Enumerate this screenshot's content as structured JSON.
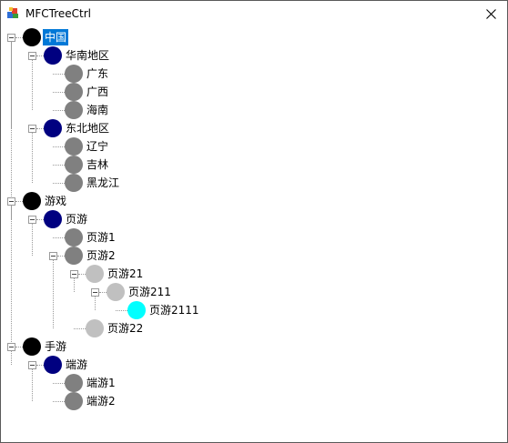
{
  "window": {
    "title": "MFCTreeCtrl",
    "close_glyph": "✕"
  },
  "colors": {
    "level0": "#000000",
    "level1": "#000080",
    "level2": "#808080",
    "level3": "#c0c0c0",
    "level4": "#00ffff",
    "selection": "#0078d7"
  },
  "tree": {
    "items": [
      {
        "label": "中国",
        "depth": 0,
        "expanded": true,
        "selected": true
      },
      {
        "label": "华南地区",
        "depth": 1,
        "expanded": true
      },
      {
        "label": "广东",
        "depth": 2
      },
      {
        "label": "广西",
        "depth": 2
      },
      {
        "label": "海南",
        "depth": 2
      },
      {
        "label": "东北地区",
        "depth": 1,
        "expanded": true
      },
      {
        "label": "辽宁",
        "depth": 2
      },
      {
        "label": "吉林",
        "depth": 2
      },
      {
        "label": "黑龙江",
        "depth": 2
      },
      {
        "label": "游戏",
        "depth": 0,
        "expanded": true
      },
      {
        "label": "页游",
        "depth": 1,
        "expanded": true
      },
      {
        "label": "页游1",
        "depth": 2
      },
      {
        "label": "页游2",
        "depth": 2,
        "expanded": true
      },
      {
        "label": "页游21",
        "depth": 3,
        "expanded": true
      },
      {
        "label": "页游211",
        "depth": 4,
        "expanded": true
      },
      {
        "label": "页游2111",
        "depth": 5
      },
      {
        "label": "页游22",
        "depth": 3
      },
      {
        "label": "手游",
        "depth": 0,
        "expanded": true
      },
      {
        "label": "端游",
        "depth": 1,
        "expanded": true
      },
      {
        "label": "端游1",
        "depth": 2
      },
      {
        "label": "端游2",
        "depth": 2
      }
    ]
  }
}
